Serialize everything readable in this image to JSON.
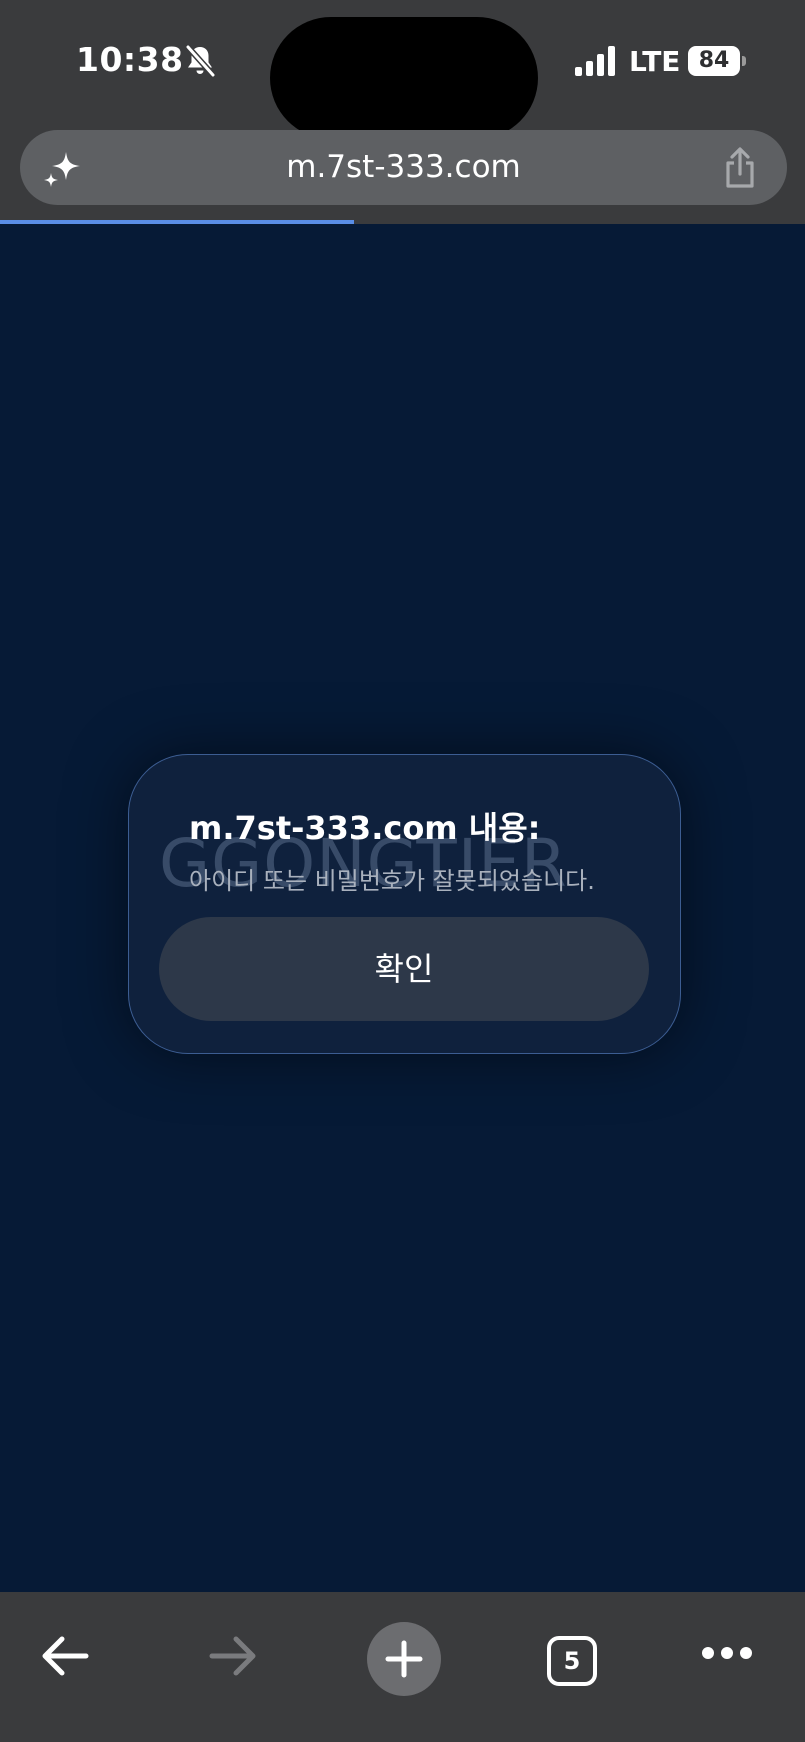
{
  "status_bar": {
    "time": "10:38",
    "network": "LTE",
    "battery": "84",
    "icons": [
      "bell-slash-icon",
      "signal-icon"
    ]
  },
  "browser": {
    "url": "m.7st-333.com",
    "load_progress": 0.44,
    "icons": [
      "sparkle-icon",
      "share-icon"
    ]
  },
  "dialog": {
    "title": "m.7st-333.com 내용:",
    "message": "아이디 또는 비밀번호가 잘못되었습니다.",
    "confirm_label": "확인",
    "background_watermark": "GGONGTIER"
  },
  "toolbar": {
    "tab_count": "5",
    "icons": [
      "back-arrow-icon",
      "forward-arrow-icon",
      "plus-icon",
      "tabs-icon",
      "more-icon"
    ]
  },
  "colors": {
    "page_background": "#061a36",
    "chrome_background": "#3a3b3d",
    "progress_accent": "#5a8ee6",
    "dialog_border": "#3c5d92",
    "button_fill": "#2d3849"
  }
}
